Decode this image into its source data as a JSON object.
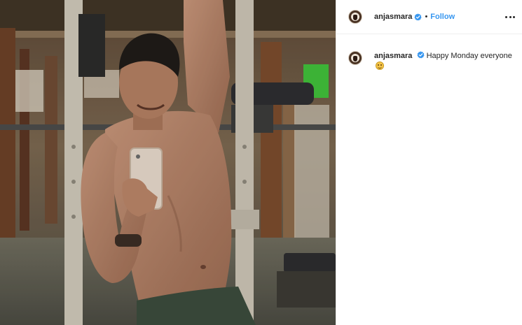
{
  "post": {
    "author": "anjasmara",
    "follow_label": "Follow",
    "separator": "•",
    "caption_author": "anjasmara",
    "caption_text": "Happy Monday everyone",
    "caption_emoji": "smiling-face-emoji"
  },
  "icons": {
    "verified": "verified-badge-icon",
    "more": "more-options-icon"
  },
  "colors": {
    "link_blue": "#3897f0",
    "verified_blue": "#3897f0",
    "divider": "#efefef"
  }
}
